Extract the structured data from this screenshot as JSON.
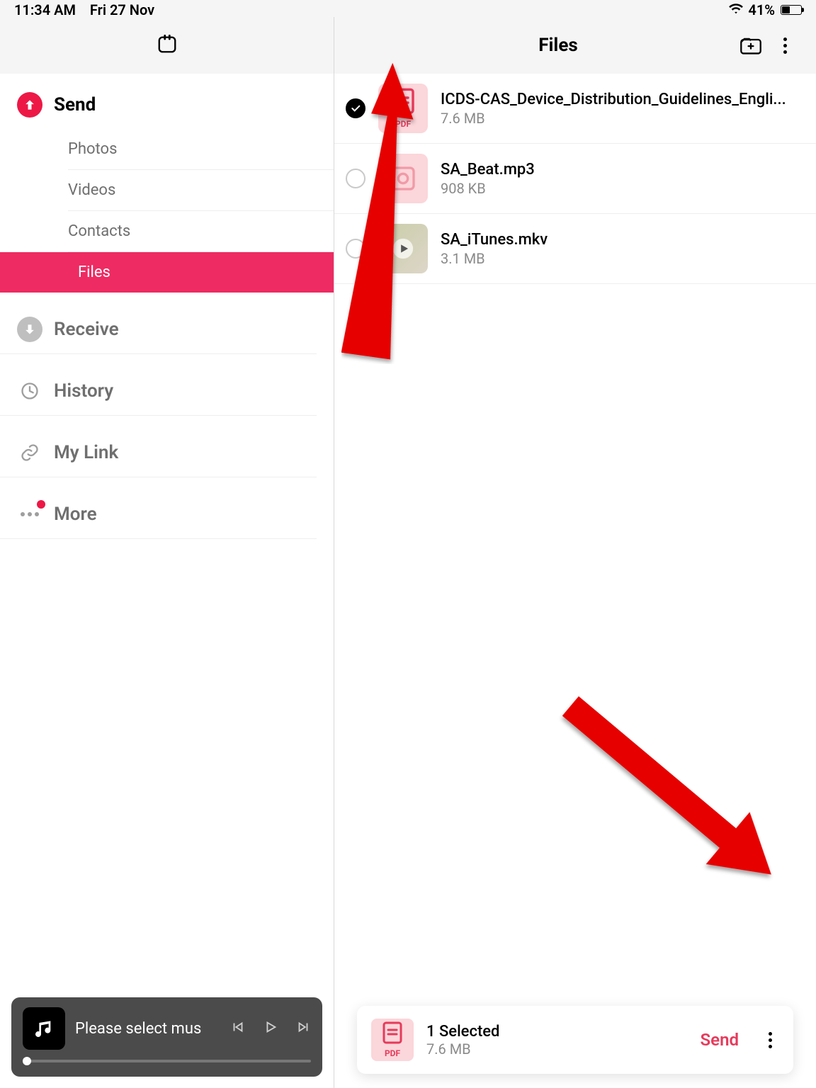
{
  "status": {
    "time": "11:34 AM",
    "date": "Fri 27 Nov",
    "battery_pct": "41%"
  },
  "header": {
    "right_title": "Files"
  },
  "sidebar": {
    "send": "Send",
    "subs": {
      "photos": "Photos",
      "videos": "Videos",
      "contacts": "Contacts",
      "files": "Files"
    },
    "receive": "Receive",
    "history": "History",
    "mylink": "My Link",
    "more": "More"
  },
  "music": {
    "title": "Please select mus"
  },
  "files": [
    {
      "name": "ICDS-CAS_Device_Distribution_Guidelines_Engli...",
      "size": "7.6 MB",
      "type": "pdf",
      "selected": true
    },
    {
      "name": "SA_Beat.mp3",
      "size": "908 KB",
      "type": "audio",
      "selected": false
    },
    {
      "name": "SA_iTunes.mkv",
      "size": "3.1 MB",
      "type": "video",
      "selected": false
    }
  ],
  "footer": {
    "selected_label": "1 Selected",
    "selected_size": "7.6 MB",
    "send_label": "Send"
  },
  "icons": {
    "pdf_badge": "PDF"
  }
}
